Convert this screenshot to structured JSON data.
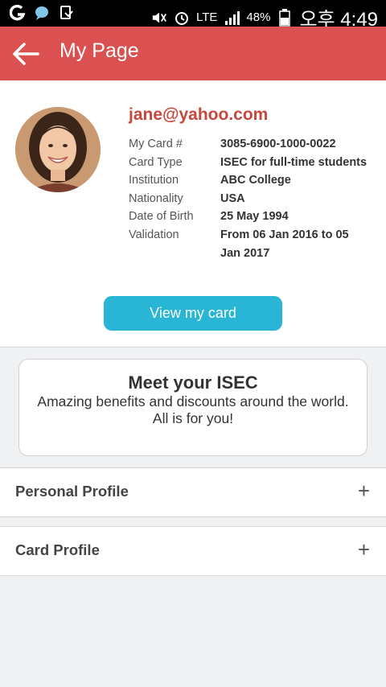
{
  "status_bar": {
    "left_icons": [
      "g-app-icon",
      "chat-bubble-icon",
      "download-icon"
    ],
    "lte": "LTE",
    "battery": "48%",
    "time": "오후 4:49"
  },
  "app_bar": {
    "title": "My Page"
  },
  "profile": {
    "email": "jane@yahoo.com",
    "fields": [
      {
        "label": "My Card #",
        "value": "3085-6900-1000-0022"
      },
      {
        "label": "Card Type",
        "value": "ISEC for full-time students"
      },
      {
        "label": "Institution",
        "value": "ABC College"
      },
      {
        "label": "Nationality",
        "value": "USA"
      },
      {
        "label": "Date of Birth",
        "value": "25 May 1994"
      },
      {
        "label": "Validation",
        "value": "From 06 Jan 2016 to 05 Jan 2017"
      }
    ],
    "button_label": "View my card"
  },
  "promo": {
    "title": "Meet your ISEC",
    "line1": "Amazing benefits and discounts around the world.",
    "line2": "All is for you!"
  },
  "sections": [
    {
      "label": "Personal Profile",
      "icon": "+"
    },
    {
      "label": "Card Profile",
      "icon": "+"
    }
  ]
}
